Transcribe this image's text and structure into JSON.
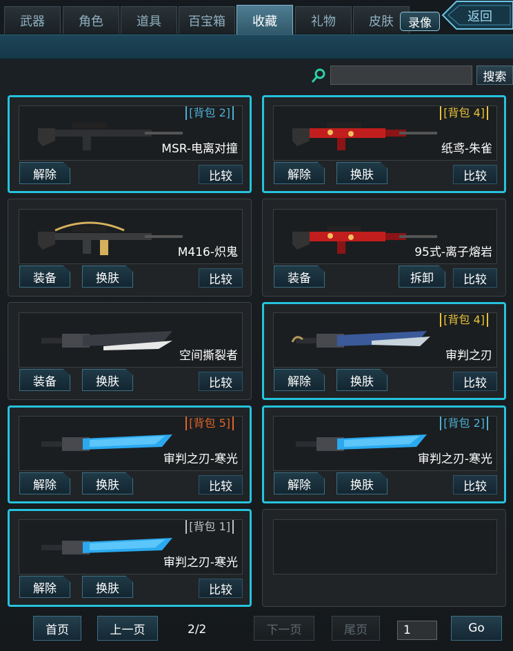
{
  "tabs": [
    "武器",
    "角色",
    "道具",
    "百宝箱",
    "收藏",
    "礼物",
    "皮肤"
  ],
  "active_tab": "收藏",
  "record_label": "录像",
  "back_label": "返回",
  "search": {
    "button_label": "搜索",
    "value": ""
  },
  "colors": {
    "accent": "#26c3dd",
    "badge_blue": "#4fb0d6",
    "badge_yellow": "#e8c23a",
    "badge_orange": "#e0642a"
  },
  "items": [
    {
      "name": "MSR-电离对撞",
      "selected": true,
      "badge": "[背包 2]",
      "badge_color": "blue",
      "actions": [
        "解除"
      ],
      "compare": "比较",
      "weapon": "sniper"
    },
    {
      "name": "纸鸢-朱雀",
      "selected": true,
      "badge": "[背包 4]",
      "badge_color": "yellow",
      "actions": [
        "解除",
        "换肤"
      ],
      "compare": "比较",
      "weapon": "rifle-red"
    },
    {
      "name": "M416-炽鬼",
      "selected": false,
      "badge": "",
      "badge_color": "",
      "actions": [
        "装备",
        "换肤"
      ],
      "compare": "比较",
      "weapon": "rifle-gold"
    },
    {
      "name": "95式-离子熔岩",
      "selected": false,
      "badge": "",
      "badge_color": "",
      "actions": [
        "装备",
        "拆卸"
      ],
      "compare": "比较",
      "weapon": "rifle-lava"
    },
    {
      "name": "空间撕裂者",
      "selected": false,
      "badge": "",
      "badge_color": "",
      "actions": [
        "装备",
        "换肤"
      ],
      "compare": "比较",
      "weapon": "blade-dark"
    },
    {
      "name": "审判之刃",
      "selected": true,
      "badge": "[背包 4]",
      "badge_color": "yellow",
      "actions": [
        "解除",
        "换肤"
      ],
      "compare": "比较",
      "weapon": "blade-blue"
    },
    {
      "name": "审判之刃-寒光",
      "selected": true,
      "badge": "[背包 5]",
      "badge_color": "orange",
      "actions": [
        "解除",
        "换肤"
      ],
      "compare": "比较",
      "weapon": "blade-ice"
    },
    {
      "name": "审判之刃-寒光",
      "selected": true,
      "badge": "[背包 2]",
      "badge_color": "blue",
      "actions": [
        "解除",
        "换肤"
      ],
      "compare": "比较",
      "weapon": "blade-ice"
    },
    {
      "name": "审判之刃-寒光",
      "selected": true,
      "badge": "[背包 1]",
      "badge_color": "gray",
      "actions": [
        "解除",
        "换肤"
      ],
      "compare": "比较",
      "weapon": "blade-ice"
    }
  ],
  "pagination": {
    "first": "首页",
    "prev": "上一页",
    "info": "2/2",
    "next": "下一页",
    "last": "尾页",
    "page_input": "1",
    "go": "Go"
  }
}
